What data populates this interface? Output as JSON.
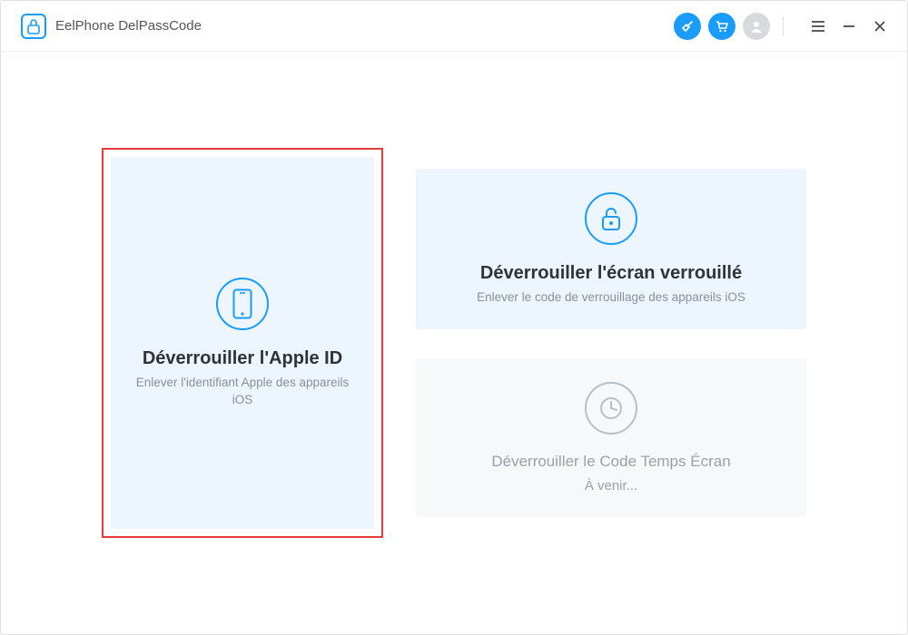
{
  "app": {
    "title": "EelPhone DelPassCode"
  },
  "cards": {
    "apple_id": {
      "title": "Déverrouiller l'Apple ID",
      "subtitle": "Enlever l'identifiant Apple des appareils iOS"
    },
    "lock_screen": {
      "title": "Déverrouiller l'écran verrouillé",
      "subtitle": "Enlever le code de verrouillage des appareils iOS"
    },
    "screen_time": {
      "title": "Déverrouiller le Code Temps Écran",
      "coming": "À venir..."
    }
  }
}
